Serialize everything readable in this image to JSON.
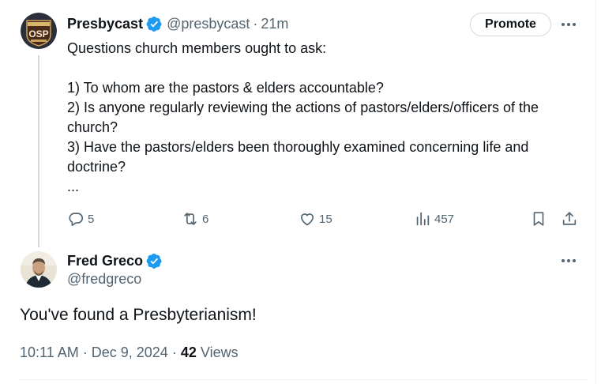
{
  "tweet1": {
    "author_name": "Presbycast",
    "handle": "@presbycast",
    "separator": "·",
    "time": "21m",
    "avatar_text": "OSP",
    "promote_label": "Promote",
    "lines": [
      "Questions church members ought to ask:",
      "",
      "1) To whom are the pastors & elders accountable?",
      "2) Is anyone regularly reviewing the actions of pastors/elders/officers of the",
      "church?",
      "3) Have the pastors/elders been thoroughly examined concerning life and",
      "doctrine?",
      "..."
    ],
    "stats": {
      "replies": "5",
      "reposts": "6",
      "likes": "15",
      "views": "457"
    }
  },
  "tweet2": {
    "author_name": "Fred Greco",
    "handle": "@fredgreco",
    "text": "You've found a Presbyterianism!",
    "time": "10:11 AM",
    "sep1": "·",
    "date": "Dec 9, 2024",
    "sep2": "·",
    "views_count": "42",
    "views_label": "Views"
  },
  "colors": {
    "verified_blue": "#1d9bf0",
    "text_primary": "#0f1419",
    "text_secondary": "#536471",
    "border": "#cfd9de"
  },
  "icons": [
    "verified-badge-icon",
    "more-icon",
    "reply-icon",
    "repost-icon",
    "like-icon",
    "views-icon",
    "bookmark-icon",
    "share-icon"
  ]
}
